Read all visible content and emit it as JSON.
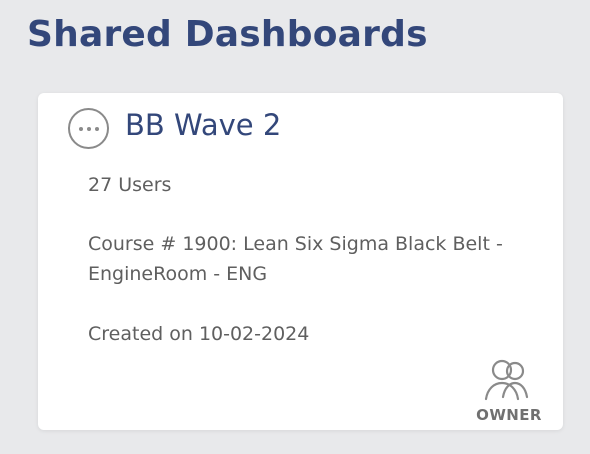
{
  "page": {
    "title": "Shared Dashboards"
  },
  "card": {
    "menu_icon": "more-horizontal-icon",
    "title": "BB Wave 2",
    "users": "27 Users",
    "course": "Course # 1900: Lean Six Sigma Black Belt - EngineRoom - ENG",
    "created": "Created on 10-02-2024",
    "owner_icon": "users-icon",
    "owner_label": "OWNER"
  },
  "colors": {
    "background": "#e8e9eb",
    "title": "#33477a",
    "text": "#5f5f5f",
    "icon": "#8a8a8a"
  }
}
